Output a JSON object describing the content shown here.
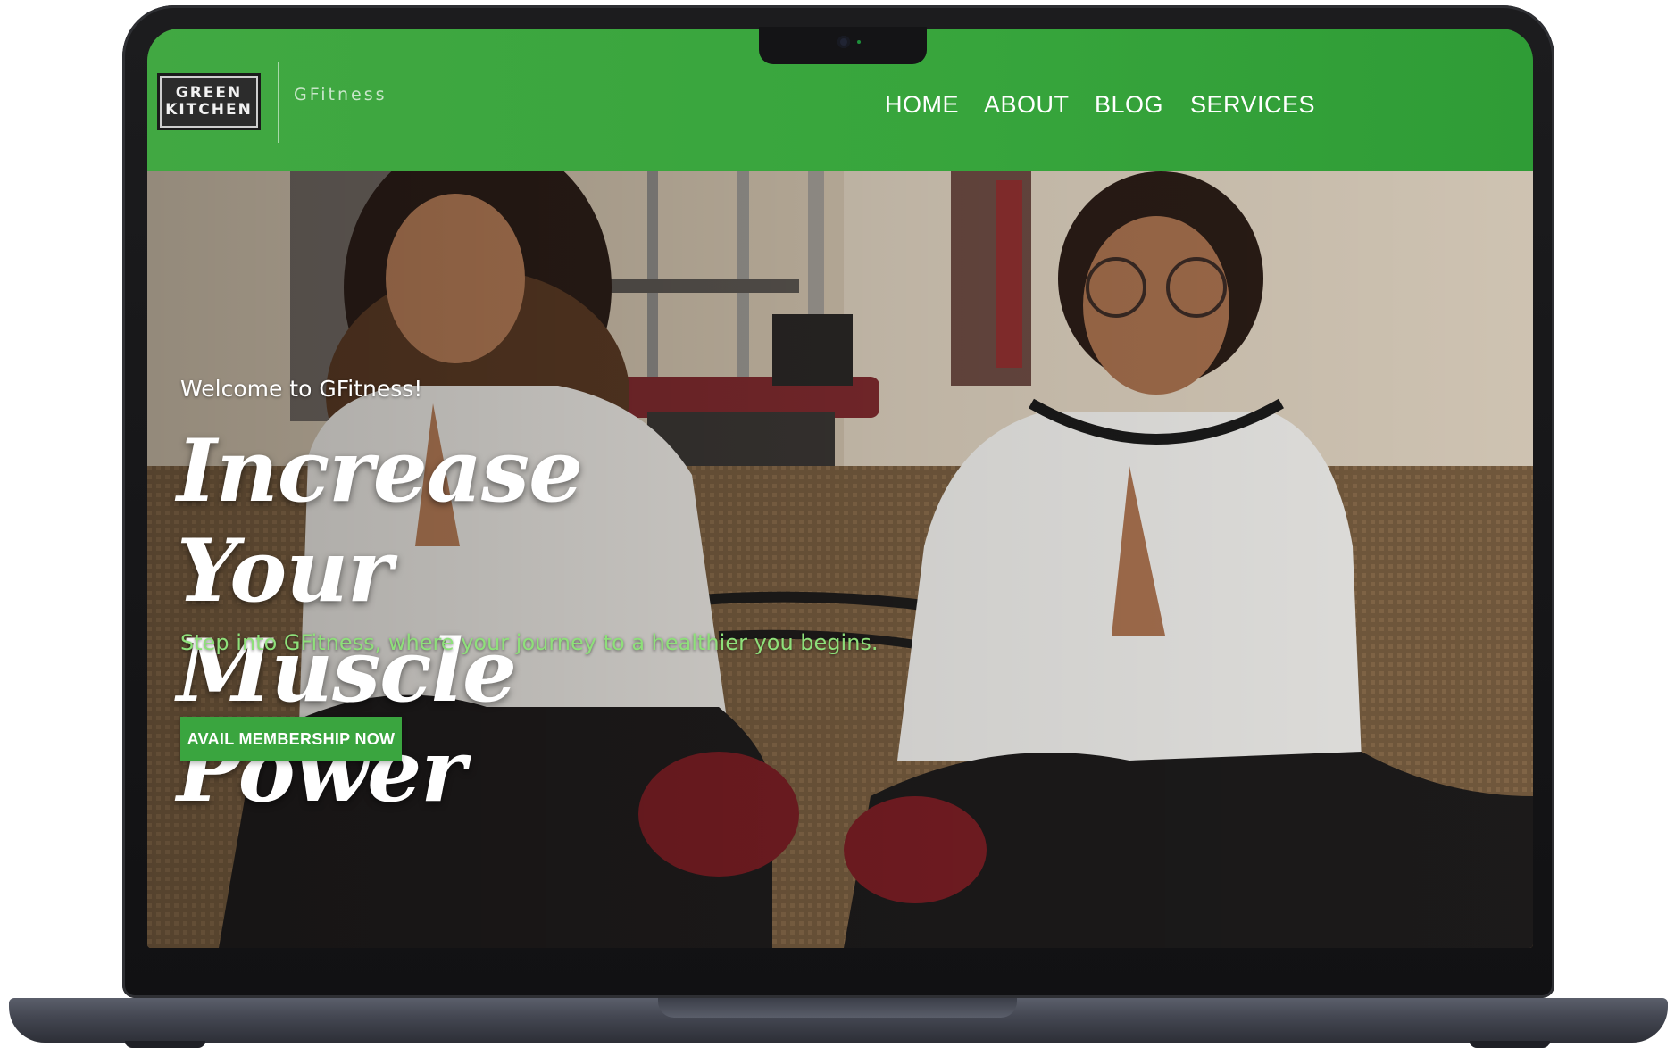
{
  "site": {
    "logo": "GREEN\nKITCHEN",
    "brand": "GFitness"
  },
  "nav": {
    "items": [
      {
        "label": "HOME"
      },
      {
        "label": "ABOUT"
      },
      {
        "label": "BLOG"
      },
      {
        "label": "SERVICES"
      }
    ]
  },
  "hero": {
    "welcome": "Welcome to GFitness!",
    "headline_line1": "Increase Your",
    "headline_line2": "Muscle Power",
    "subtitle": "Step into GFitness, where your journey to a healthier you begins.",
    "cta_label": "AVAIL MEMBERSHIP NOW"
  },
  "colors": {
    "header_green": "#3aa53f",
    "subtitle_green": "#8ee07a",
    "button_green": "#3aa53f"
  }
}
